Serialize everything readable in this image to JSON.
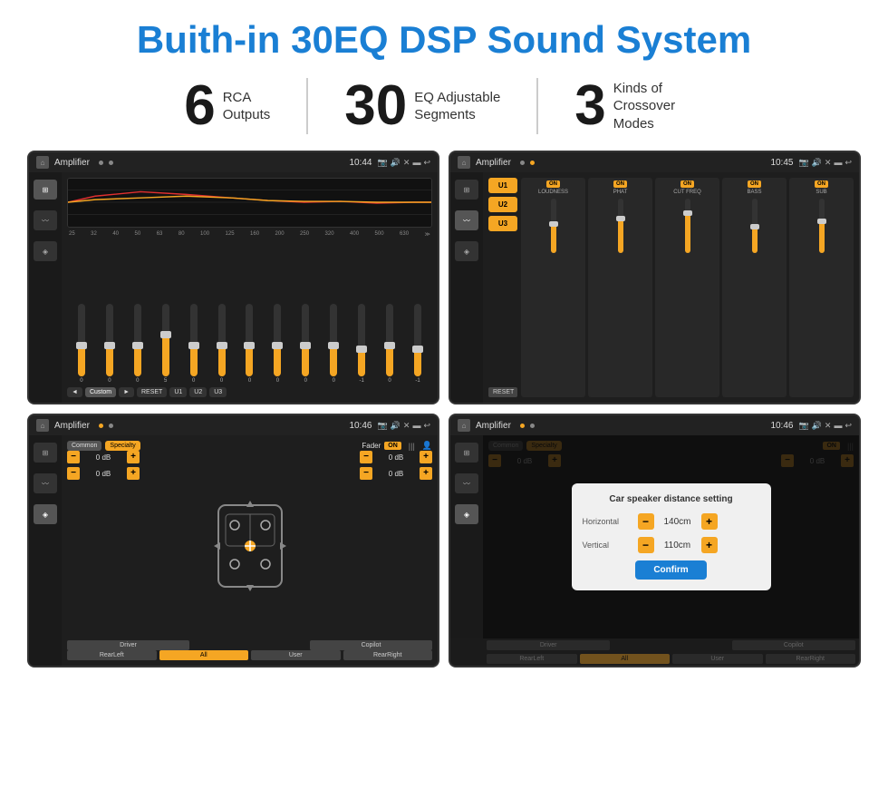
{
  "header": {
    "title": "Buith-in 30EQ DSP Sound System"
  },
  "stats": [
    {
      "number": "6",
      "text_line1": "RCA",
      "text_line2": "Outputs"
    },
    {
      "number": "30",
      "text_line1": "EQ Adjustable",
      "text_line2": "Segments"
    },
    {
      "number": "3",
      "text_line1": "Kinds of",
      "text_line2": "Crossover Modes"
    }
  ],
  "screens": {
    "eq": {
      "status_title": "Amplifier",
      "time": "10:44",
      "eq_bands": [
        "25",
        "32",
        "40",
        "50",
        "63",
        "80",
        "100",
        "125",
        "160",
        "200",
        "250",
        "320",
        "400",
        "500",
        "630"
      ],
      "eq_values": [
        "0",
        "0",
        "0",
        "5",
        "0",
        "0",
        "0",
        "0",
        "0",
        "0",
        "-1",
        "0",
        "-1"
      ],
      "preset_label": "Custom",
      "buttons": [
        "◄",
        "Custom",
        "►",
        "RESET",
        "U1",
        "U2",
        "U3"
      ]
    },
    "crossover": {
      "status_title": "Amplifier",
      "time": "10:45",
      "u_buttons": [
        "U1",
        "U2",
        "U3"
      ],
      "controls": [
        "LOUDNESS",
        "PHAT",
        "CUT FREQ",
        "BASS",
        "SUB"
      ],
      "reset_label": "RESET"
    },
    "fader": {
      "status_title": "Amplifier",
      "time": "10:46",
      "tabs": [
        "Common",
        "Specialty"
      ],
      "fader_label": "Fader",
      "on_label": "ON",
      "db_values": [
        "0 dB",
        "0 dB",
        "0 dB",
        "0 dB"
      ],
      "buttons": [
        "Driver",
        "RearLeft",
        "All",
        "User",
        "Copilot",
        "RearRight"
      ]
    },
    "dialog": {
      "status_title": "Amplifier",
      "time": "10:46",
      "tabs": [
        "Common",
        "Specialty"
      ],
      "dialog_title": "Car speaker distance setting",
      "horizontal_label": "Horizontal",
      "horizontal_value": "140cm",
      "vertical_label": "Vertical",
      "vertical_value": "110cm",
      "confirm_label": "Confirm",
      "db_values": [
        "0 dB",
        "0 dB"
      ],
      "buttons": [
        "Driver",
        "RearLeft",
        "All",
        "User",
        "Copilot",
        "RearRight"
      ]
    }
  }
}
